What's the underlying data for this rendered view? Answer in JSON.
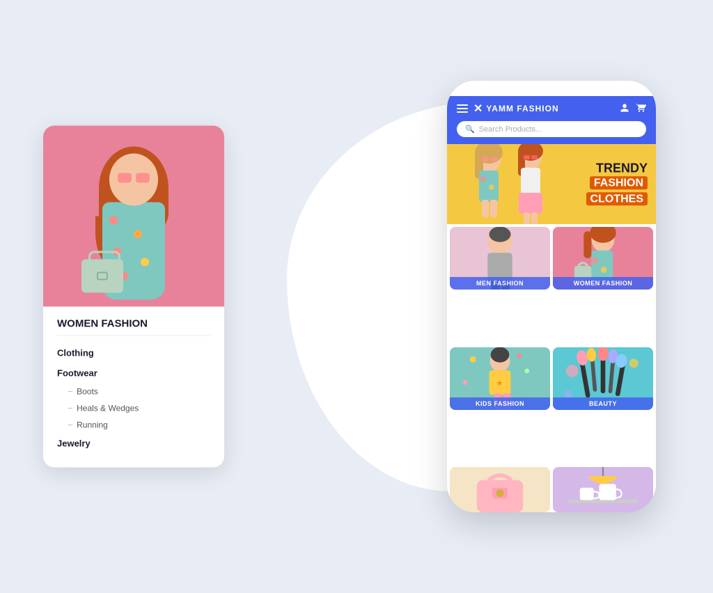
{
  "app": {
    "title": "YAMM FASHION",
    "logo_icon": "✕",
    "search_placeholder": "Search Products...",
    "header_bg": "#4361ee"
  },
  "banner": {
    "line1": "TRENDY",
    "line2": "FASHION",
    "line3": "CLOTHES"
  },
  "categories": [
    {
      "id": "men",
      "label": "MEN FASHION",
      "bg": "#e8c4d4"
    },
    {
      "id": "women",
      "label": "WOMEN FASHION",
      "bg": "#e8829a"
    },
    {
      "id": "kids",
      "label": "KIDS FASHION",
      "bg": "#7ec8c0"
    },
    {
      "id": "beauty",
      "label": "BEAUTY",
      "bg": "#5bc8d4"
    },
    {
      "id": "bags",
      "label": "",
      "bg": "#f5e6c8"
    },
    {
      "id": "home",
      "label": "",
      "bg": "#d4b8e8"
    }
  ],
  "left_card": {
    "title": "WOMEN FASHION",
    "nav_items": [
      {
        "label": "Clothing",
        "bold": true,
        "sub": []
      },
      {
        "label": "Footwear",
        "bold": true,
        "sub": [
          "Boots",
          "Heals & Wedges",
          "Running"
        ]
      },
      {
        "label": "Jewelry",
        "bold": true,
        "sub": []
      }
    ]
  },
  "hamburger_label": "menu",
  "user_icon": "👤",
  "cart_icon": "🛒"
}
